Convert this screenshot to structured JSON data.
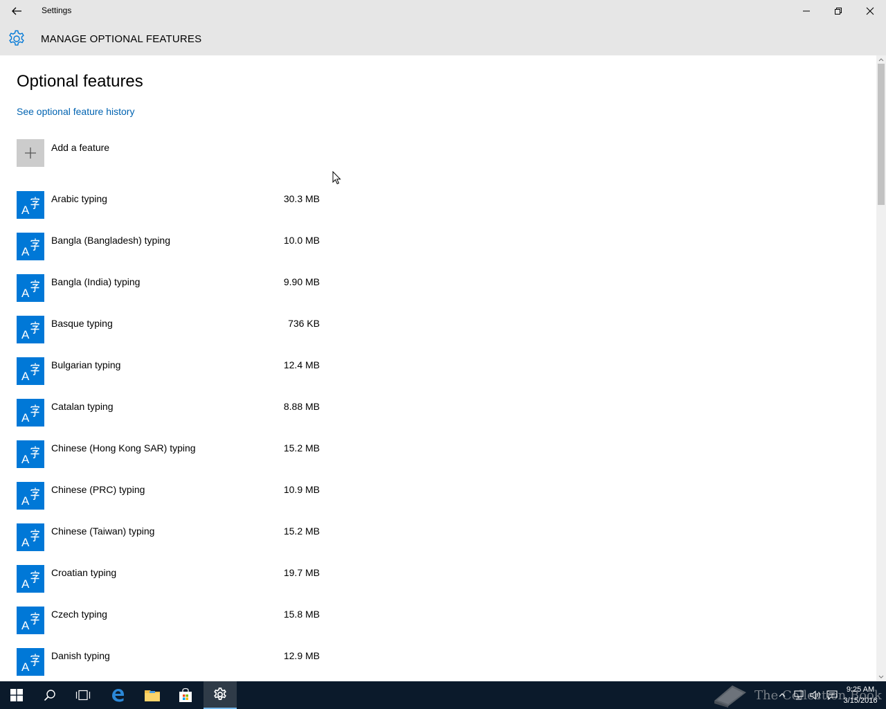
{
  "window": {
    "title": "Settings"
  },
  "header": {
    "title": "MANAGE OPTIONAL FEATURES"
  },
  "main": {
    "page_title": "Optional features",
    "history_link": "See optional feature history",
    "add_feature_label": "Add a feature",
    "features": [
      {
        "name": "Arabic typing",
        "size": "30.3 MB"
      },
      {
        "name": "Bangla (Bangladesh) typing",
        "size": "10.0 MB"
      },
      {
        "name": "Bangla (India) typing",
        "size": "9.90 MB"
      },
      {
        "name": "Basque typing",
        "size": "736 KB"
      },
      {
        "name": "Bulgarian typing",
        "size": "12.4 MB"
      },
      {
        "name": "Catalan typing",
        "size": "8.88 MB"
      },
      {
        "name": "Chinese (Hong Kong SAR) typing",
        "size": "15.2 MB"
      },
      {
        "name": "Chinese (PRC) typing",
        "size": "10.9 MB"
      },
      {
        "name": "Chinese (Taiwan) typing",
        "size": "15.2 MB"
      },
      {
        "name": "Croatian typing",
        "size": "19.7 MB"
      },
      {
        "name": "Czech typing",
        "size": "15.8 MB"
      },
      {
        "name": "Danish typing",
        "size": "12.9 MB"
      }
    ],
    "feature_icon": "language-typing-icon"
  },
  "taskbar": {
    "watermark": "The Collection Book",
    "clock_time": "9:25 AM",
    "clock_date": "3/15/2016"
  },
  "colors": {
    "accent": "#0078d7",
    "link": "#0063b1",
    "chrome": "#e6e6e6",
    "taskbar": "#0b1a2b"
  }
}
